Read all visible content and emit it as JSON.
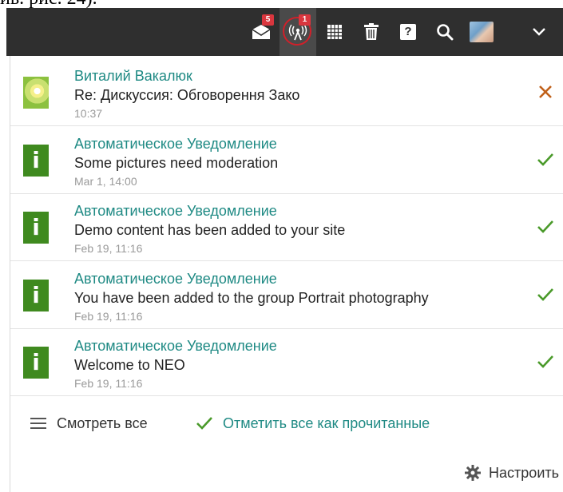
{
  "caption": "ив. рис. 24).",
  "topbar": {
    "messages_badge": "5",
    "notifications_badge": "1",
    "icons": [
      "mail-icon",
      "broadcast-icon",
      "calendar-grid-icon",
      "trash-icon",
      "help-icon",
      "search-icon",
      "avatar",
      "chevron-down-icon"
    ],
    "help_glyph": "?"
  },
  "notifications": [
    {
      "sender": "Виталий Вакалюк",
      "message": "Re: Дискуссия: Обговорення Зако",
      "time": "10:37",
      "icon": "photo-thumbnail",
      "action": "close-icon"
    },
    {
      "sender": "Автоматическое Уведомление",
      "message": "Some pictures need moderation",
      "time": "Mar 1, 14:00",
      "icon": "info-icon",
      "action": "check-icon"
    },
    {
      "sender": "Автоматическое Уведомление",
      "message": "Demo content has been added to your site",
      "time": "Feb 19, 11:16",
      "icon": "info-icon",
      "action": "check-icon"
    },
    {
      "sender": "Автоматическое Уведомление",
      "message": "You have been added to the group Portrait photography",
      "time": "Feb 19, 11:16",
      "icon": "info-icon",
      "action": "check-icon"
    },
    {
      "sender": "Автоматическое Уведомление",
      "message": "Welcome to NEO",
      "time": "Feb 19, 11:16",
      "icon": "info-icon",
      "action": "check-icon"
    }
  ],
  "info_glyph": "i",
  "footer": {
    "view_all": "Смотреть все",
    "mark_all_read": "Отметить все как прочитанные",
    "settings": "Настроить"
  },
  "colors": {
    "topbar": "#2f2f2f",
    "accent_teal": "#1f8a84",
    "info_green": "#3f8a1f",
    "check_green": "#4a9a2a",
    "close_orange": "#c0601a",
    "badge_red": "#d9363e"
  }
}
